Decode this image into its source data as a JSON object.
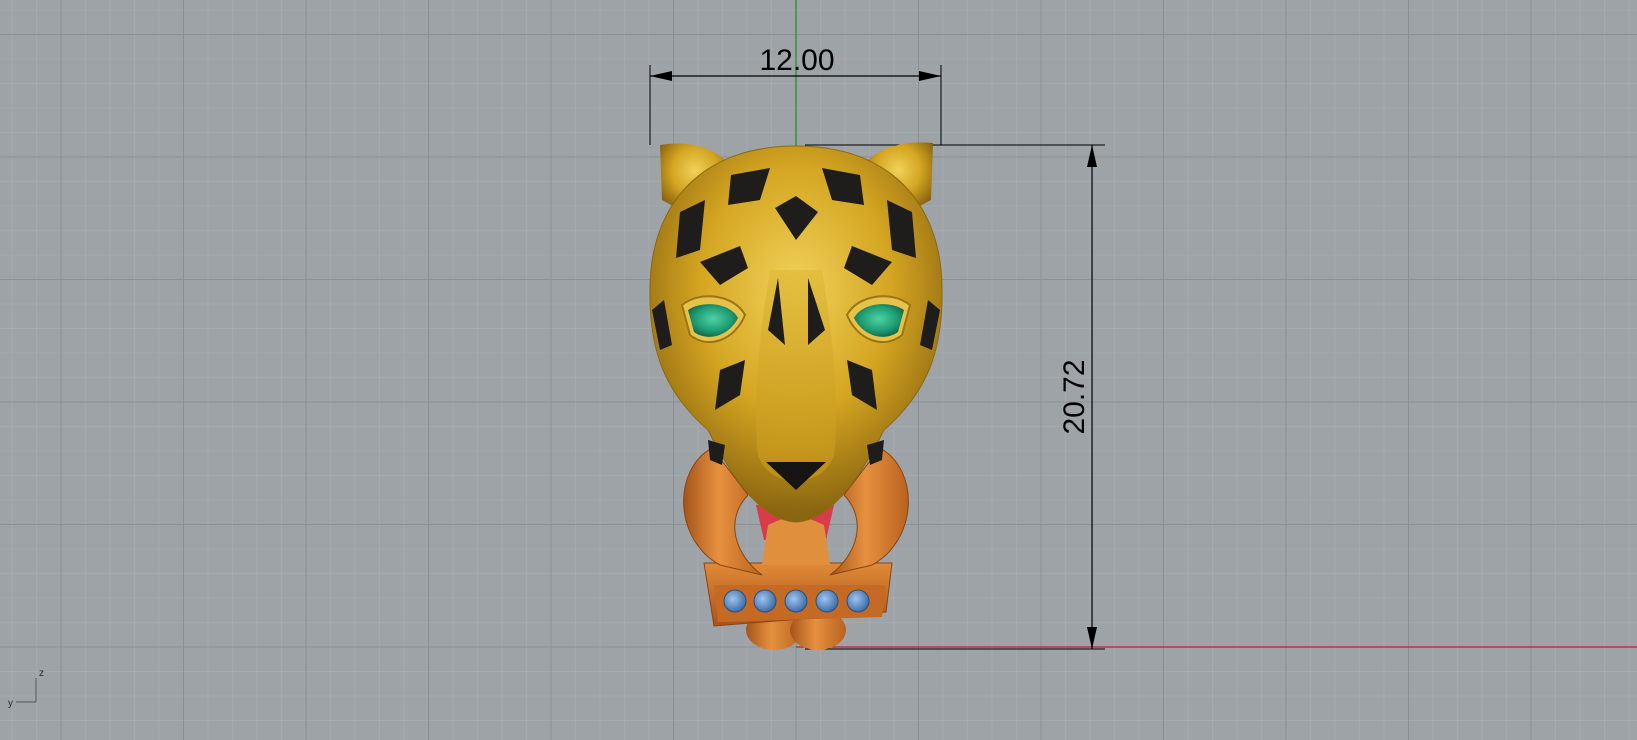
{
  "viewport": {
    "colors": {
      "background": "#9ea3a8",
      "grid_minor": "#a9adb1",
      "grid_major": "#8b9095",
      "axis_x": "#b5262a",
      "axis_y": "#1f8a2c",
      "dimension_line": "#000000"
    }
  },
  "dimensions": {
    "width_value": "12.00",
    "height_value": "20.72"
  },
  "model": {
    "object_name": "leopard-head-pendant",
    "colors": {
      "gold": "#d4a521",
      "gold_highlight": "#f0d25a",
      "gold_shadow": "#9c7412",
      "spots": "#1e1d1b",
      "eyes": "#1f9e74",
      "copper": "#d5792b",
      "copper_dark": "#a6541a",
      "gem_blue": "#5b8fc9",
      "ruby": "#d83b4a"
    }
  },
  "axis_gizmo": {
    "z_label": "z",
    "y_label": "y"
  }
}
